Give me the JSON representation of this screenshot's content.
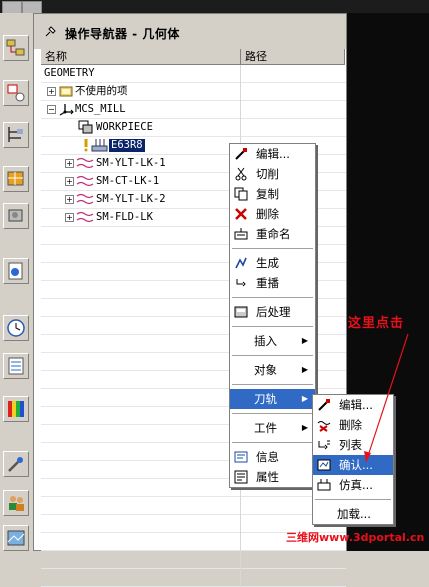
{
  "navigator": {
    "title": "操作导航器 - 几何体",
    "columns": {
      "name": "名称",
      "path": "路径"
    }
  },
  "tree": [
    {
      "label": "GEOMETRY"
    },
    {
      "label": "不使用的项"
    },
    {
      "label": "MCS_MILL"
    },
    {
      "label": "WORKPIECE"
    },
    {
      "label": "E63R8"
    },
    {
      "label": "SM-YLT-LK-1"
    },
    {
      "label": "SM-CT-LK-1"
    },
    {
      "label": "SM-YLT-LK-2"
    },
    {
      "label": "SM-FLD-LK"
    }
  ],
  "context_menu": {
    "items": [
      {
        "label": "编辑...",
        "icon": "edit-icon"
      },
      {
        "label": "切削",
        "icon": "cut-icon"
      },
      {
        "label": "复制",
        "icon": "copy-icon"
      },
      {
        "label": "删除",
        "icon": "delete-icon"
      },
      {
        "label": "重命名",
        "icon": "rename-icon"
      },
      {
        "label": "生成",
        "icon": "generate-icon"
      },
      {
        "label": "重播",
        "icon": "replay-icon"
      },
      {
        "label": "后处理",
        "icon": "postprocess-icon"
      },
      {
        "label": "插入"
      },
      {
        "label": "对象"
      },
      {
        "label": "刀轨"
      },
      {
        "label": "工件"
      },
      {
        "label": "信息",
        "icon": "info-icon"
      },
      {
        "label": "属性",
        "icon": "properties-icon"
      }
    ]
  },
  "toolpath_submenu": {
    "items": [
      {
        "label": "编辑..."
      },
      {
        "label": "删除"
      },
      {
        "label": "列表"
      },
      {
        "label": "确认..."
      },
      {
        "label": "仿真..."
      },
      {
        "label": "加载..."
      }
    ]
  },
  "annotation": "这里点击",
  "watermark": "三维网www.3dportal.cn",
  "colors": {
    "selection": "#316ac5",
    "annotation": "#e8101a"
  }
}
